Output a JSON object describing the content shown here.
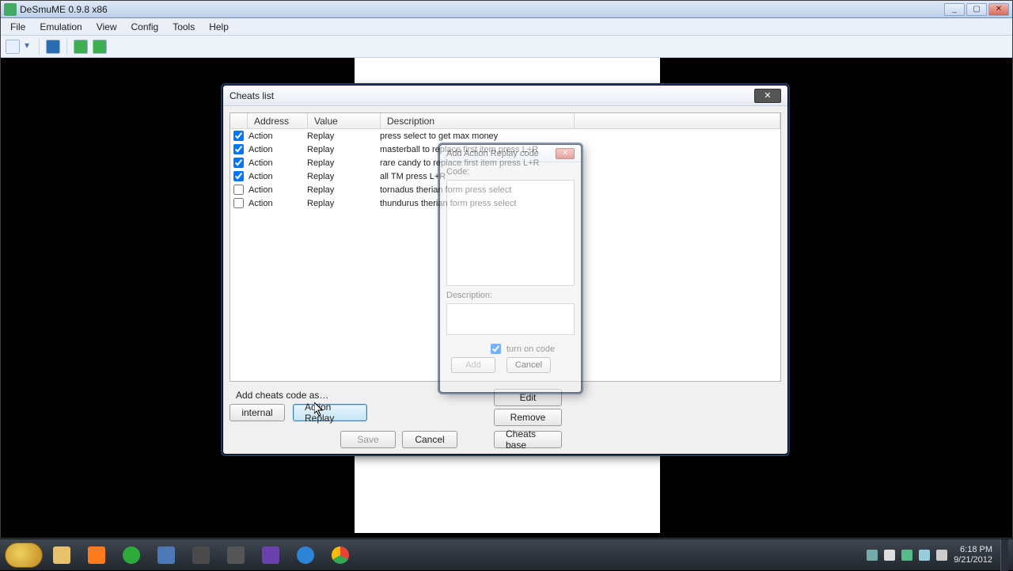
{
  "window": {
    "title": "DeSmuME 0.9.8 x86",
    "min": "_",
    "max": "▢",
    "close": "✕"
  },
  "menu": {
    "file": "File",
    "emulation": "Emulation",
    "view": "View",
    "config": "Config",
    "tools": "Tools",
    "help": "Help"
  },
  "cheats_dialog": {
    "title": "Cheats list",
    "close": "✕",
    "headers": {
      "address": "Address",
      "value": "Value",
      "description": "Description"
    },
    "rows": [
      {
        "on": true,
        "addr": "Action",
        "val": "Replay",
        "desc": "press select to get max money"
      },
      {
        "on": true,
        "addr": "Action",
        "val": "Replay",
        "desc": "masterball to replace first item press L+R"
      },
      {
        "on": true,
        "addr": "Action",
        "val": "Replay",
        "desc": "rare candy to replace first item press L+R"
      },
      {
        "on": true,
        "addr": "Action",
        "val": "Replay",
        "desc": "all TM press L+R"
      },
      {
        "on": false,
        "addr": "Action",
        "val": "Replay",
        "desc": "tornadus therian form press select"
      },
      {
        "on": false,
        "addr": "Action",
        "val": "Replay",
        "desc": "thundurus therian form press select"
      }
    ],
    "add_label": "Add cheats code as…",
    "buttons": {
      "internal": "internal",
      "action_replay": "Action Replay",
      "save": "Save",
      "cancel": "Cancel",
      "edit": "Edit",
      "remove": "Remove",
      "cheats_base": "Cheats base"
    }
  },
  "ar_dialog": {
    "title": "Add Action Replay code",
    "code_label": "Code:",
    "desc_label": "Description:",
    "turn_on": "turn on code",
    "add": "Add",
    "cancel": "Cancel",
    "close": "✕"
  },
  "taskbar": {
    "time": "6:18 PM",
    "date": "9/21/2012"
  },
  "colors": {
    "accent": "#3c7fb1",
    "dialog_bg": "#f0f0f0"
  }
}
